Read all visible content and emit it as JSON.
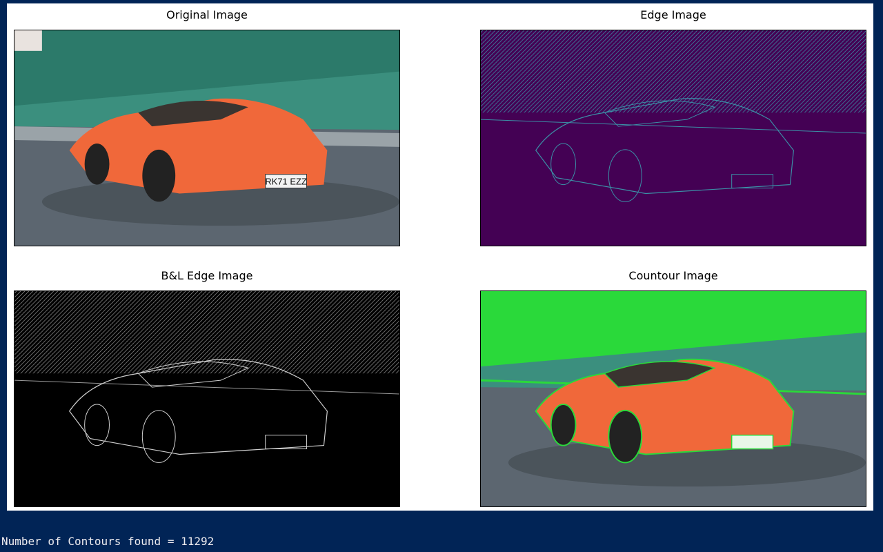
{
  "figure": {
    "panels": [
      {
        "title": "Original Image",
        "icon": "photo-car-original"
      },
      {
        "title": "Edge Image",
        "icon": "photo-car-edges-viridis"
      },
      {
        "title": "B&L Edge Image",
        "icon": "photo-car-edges-bw"
      },
      {
        "title": "Countour Image",
        "icon": "photo-car-contours"
      }
    ],
    "plate_text": "RK71 EZZ"
  },
  "console": {
    "output_line": "Number of Contours found = 11292"
  },
  "colors": {
    "console_bg": "#012456",
    "car_orange": "#f0683a",
    "viridis_dark": "#440154",
    "viridis_line": "#3b8fa6",
    "contour_green": "#2ad93a"
  }
}
